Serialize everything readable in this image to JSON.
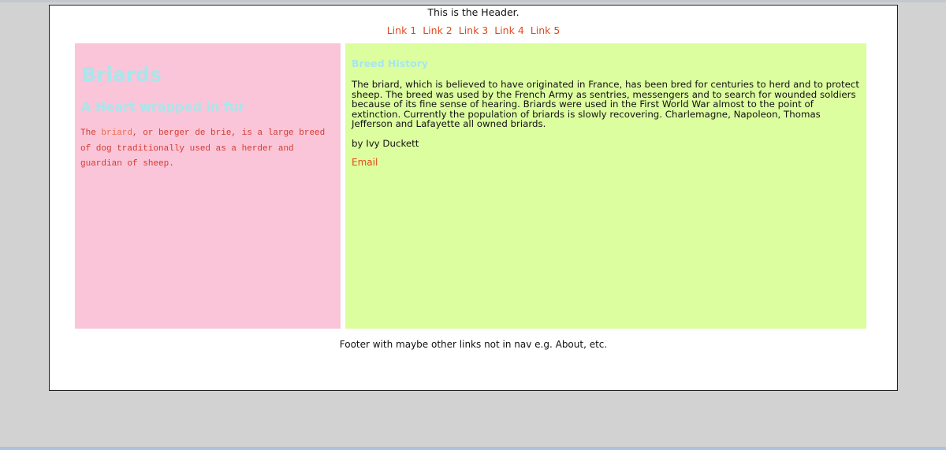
{
  "header": {
    "text": "This is the Header."
  },
  "nav": {
    "links": [
      "Link 1",
      "Link 2",
      "Link 3",
      "Link 4",
      "Link 5"
    ]
  },
  "left": {
    "title": "Briards",
    "subtitle": "A Heart wrapped in fur",
    "intro_prefix": "The ",
    "intro_link": "briard",
    "intro_suffix": ", or berger de brie, is a large breed of dog traditionally used as a herder and guardian of sheep."
  },
  "right": {
    "section_title": "Breed History",
    "paragraph": "The briard, which is believed to have originated in France, has been bred for centuries to herd and to protect sheep. The breed was used by the French Army as sentries, messengers and to search for wounded soldiers because of its fine sense of hearing. Briards were used in the First World War almost to the point of extinction. Currently the population of briards is slowly recovering. Charlemagne, Napoleon, Thomas Jefferson and Lafayette all owned briards.",
    "byline": "by Ivy Duckett",
    "email_label": "Email"
  },
  "footer": {
    "text": "Footer with maybe other links not in nav e.g. About, etc."
  },
  "colors": {
    "background": "#d2d2d2",
    "page": "#ffffff",
    "link": "#e04a1c",
    "left_column": "#fac5d8",
    "right_column": "#ddfe9f",
    "heading": "#a8e6ec",
    "intro_text": "#d43b2f"
  }
}
